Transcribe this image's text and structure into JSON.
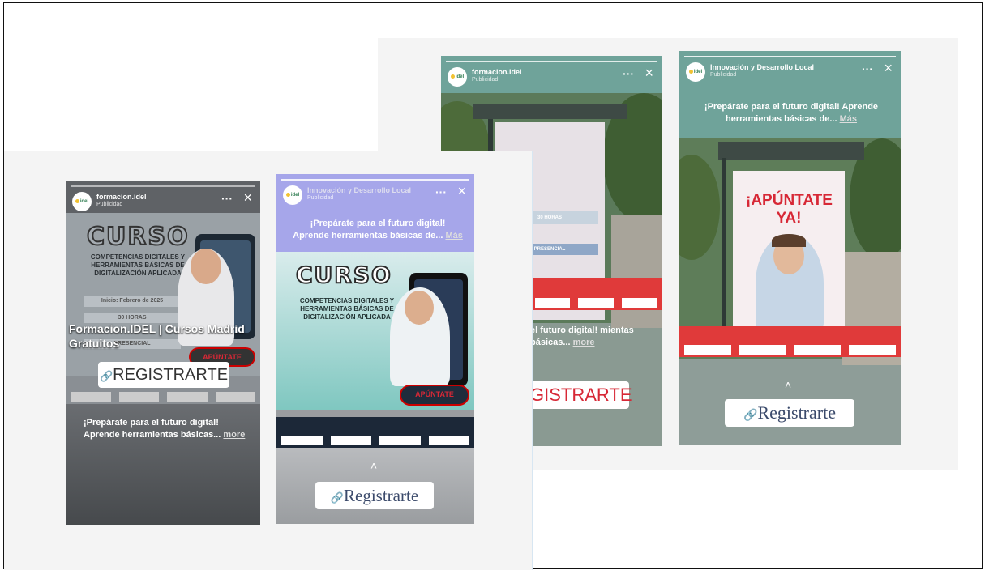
{
  "stories": {
    "left_1": {
      "username": "formacion.idel",
      "sublabel": "Publicidad",
      "avatar_text": "idel",
      "headline_curso": "CURSO",
      "headline_sub": "COMPETENCIAS DIGITALES Y HERRAMIENTAS BÁSICAS DE DIGITALIZACIÓN APLICADA",
      "overlay_title": "Formacion.IDEL | Cursos Madrid Gratuitos",
      "info_1": "Inicio: Febrero de 2025",
      "info_2": "30 HORAS",
      "info_3": "PRESENCIAL",
      "cta_inline": "APÚNTATE",
      "register_label": "REGISTRARTE",
      "caption": "¡Prepárate para el futuro digital! Aprende herramientas básicas...",
      "more": "more"
    },
    "left_2": {
      "username": "Innovación y Desarrollo Local",
      "sublabel": "Publicidad",
      "avatar_text": "idel",
      "caption": "¡Prepárate para el futuro digital! Aprende herramientas básicas de...",
      "more": "Más",
      "headline_curso": "CURSO",
      "headline_sub": "COMPETENCIAS DIGITALES Y HERRAMIENTAS BÁSICAS DE DIGITALIZACIÓN APLICADA",
      "cta_inline": "APÚNTATE",
      "register_label": "Registrarte"
    },
    "right_1": {
      "username": "formacion.idel",
      "sublabel": "Publicidad",
      "avatar_text": "idel",
      "info_1": "30 HORAS",
      "info_2": "PRESENCIAL",
      "caption": "el futuro digital! mientas básicas...",
      "more": "more",
      "register_label": "GISTRARTE"
    },
    "right_2": {
      "username": "Innovación y Desarrollo Local",
      "sublabel": "Publicidad",
      "avatar_text": "idel",
      "caption": "¡Prepárate para el futuro digital! Aprende herramientas básicas de...",
      "more": "Más",
      "billboard_text": "¡APÚNTATE YA!",
      "register_label": "Registrarte"
    }
  },
  "icons": {
    "close": "×",
    "more_dots": "···",
    "link": "🔗",
    "chevron_up": "˄"
  },
  "colors": {
    "accent_red": "#d72836",
    "teal_header": "#6fa39a",
    "purple_header": "#a6a6ea"
  }
}
